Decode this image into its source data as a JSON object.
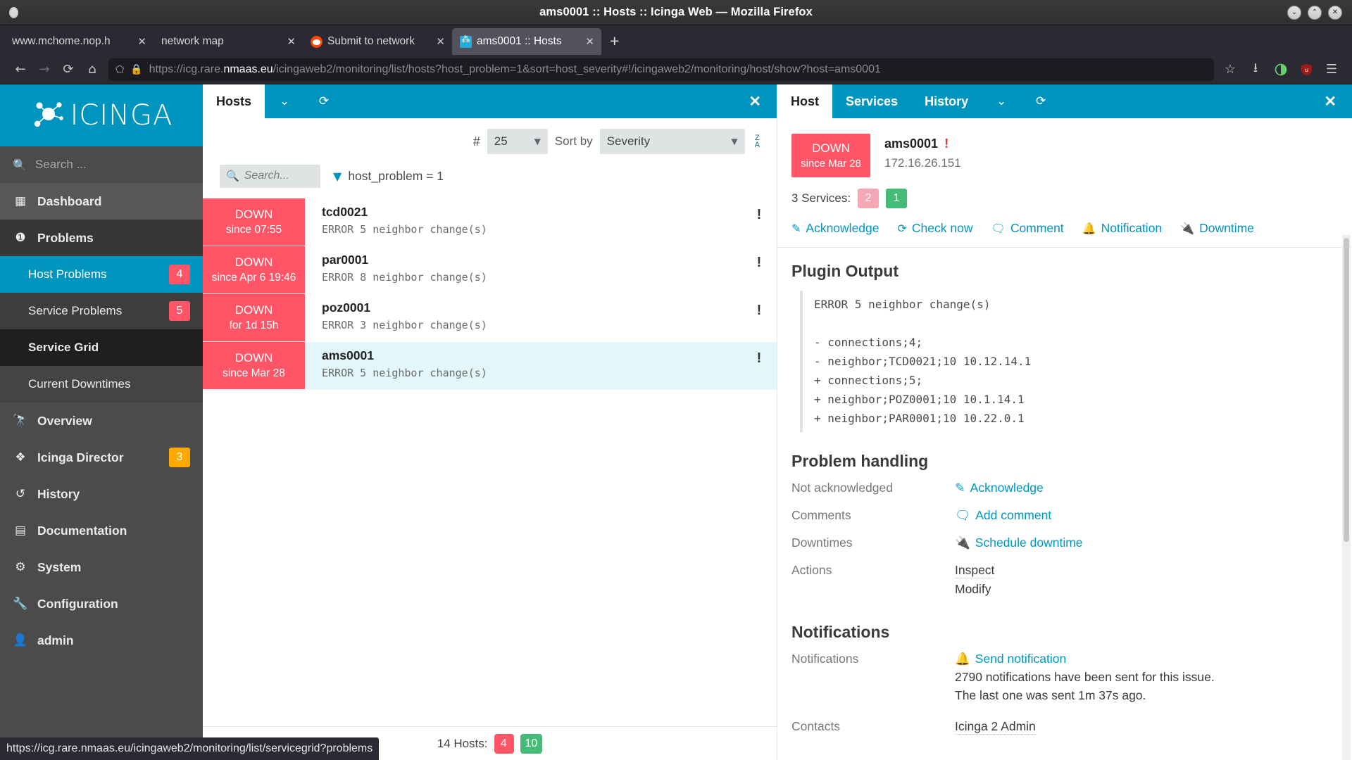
{
  "browser": {
    "window_title": "ams0001 :: Hosts :: Icinga Web — Mozilla Firefox",
    "window_controls": {
      "minimize": "⌄",
      "maximize": "⌃",
      "close": "✕"
    },
    "tabs": [
      {
        "label": "www.mchome.nop.h",
        "favicon": "generic-favicon",
        "active": false
      },
      {
        "label": "network map",
        "favicon": "none",
        "active": false
      },
      {
        "label": "Submit to network",
        "favicon": "reddit-favicon",
        "active": false
      },
      {
        "label": "ams0001 :: Hosts",
        "favicon": "icinga-favicon",
        "active": true
      }
    ],
    "new_tab_label": "+",
    "nav": {
      "back": "←",
      "forward": "→",
      "reload": "⟳",
      "home": "⌂",
      "shield_icon": "shield-icon",
      "lock_icon": "lock-icon",
      "url_prefix": "https://icg.rare.",
      "url_domain": "nmaas.eu",
      "url_suffix": "/icingaweb2/monitoring/list/hosts?host_problem=1&sort=host_severity#!/icingaweb2/monitoring/host/show?host=ams0001",
      "bookmark": "☆",
      "downloads": "⭳",
      "container": "◑",
      "extension": "U",
      "menu": "☰"
    },
    "status_tip": "https://icg.rare.nmaas.eu/icingaweb2/monitoring/list/servicegrid?problems"
  },
  "sidebar": {
    "brand": "ICINGA",
    "search": {
      "placeholder": "Search ...",
      "value": "",
      "icon": "search-icon"
    },
    "items": [
      {
        "label": "Dashboard",
        "icon": "grid-icon",
        "badge": null,
        "level": 1
      },
      {
        "label": "Problems",
        "icon": "exclamation-circle-icon",
        "badge": null,
        "level": 1
      },
      {
        "label": "Host Problems",
        "icon": null,
        "badge": "4",
        "badge_color": "red",
        "level": 2
      },
      {
        "label": "Service Problems",
        "icon": null,
        "badge": "5",
        "badge_color": "red",
        "level": 2
      },
      {
        "label": "Service Grid",
        "icon": null,
        "badge": null,
        "level": 2
      },
      {
        "label": "Current Downtimes",
        "icon": null,
        "badge": null,
        "level": 2
      },
      {
        "label": "Overview",
        "icon": "binoculars-icon",
        "badge": null,
        "level": 1
      },
      {
        "label": "Icinga Director",
        "icon": "cubes-icon",
        "badge": "3",
        "badge_color": "orange",
        "level": 1
      },
      {
        "label": "History",
        "icon": "history-icon",
        "badge": null,
        "level": 1
      },
      {
        "label": "Documentation",
        "icon": "book-icon",
        "badge": null,
        "level": 1
      },
      {
        "label": "System",
        "icon": "gears-icon",
        "badge": null,
        "level": 1
      },
      {
        "label": "Configuration",
        "icon": "wrench-icon",
        "badge": null,
        "level": 1
      },
      {
        "label": "admin",
        "icon": "user-icon",
        "badge": null,
        "level": 1
      }
    ]
  },
  "hosts_pane": {
    "tab_label": "Hosts",
    "dropdown_icon": "chevron-down-icon",
    "refresh_icon": "refresh-icon",
    "close_icon": "close-icon",
    "controls": {
      "hash_label": "#",
      "limit_value": "25",
      "sort_by_label": "Sort by",
      "sort_value": "Severity",
      "sort_direction_icon": "sort-desc-icon"
    },
    "search": {
      "placeholder": "Search...",
      "value": "",
      "icon": "search-icon"
    },
    "filter": {
      "icon": "filter-icon",
      "text": "host_problem = 1"
    },
    "rows": [
      {
        "state": "DOWN",
        "since": "since 07:55",
        "name": "tcd0021",
        "message": "ERROR 5 neighbor change(s)",
        "flag": "!",
        "selected": false
      },
      {
        "state": "DOWN",
        "since": "since Apr 6 19:46",
        "name": "par0001",
        "message": "ERROR 8 neighbor change(s)",
        "flag": "!",
        "selected": false
      },
      {
        "state": "DOWN",
        "since": "for 1d 15h",
        "name": "poz0001",
        "message": "ERROR 3 neighbor change(s)",
        "flag": "!",
        "selected": false
      },
      {
        "state": "DOWN",
        "since": "since Mar 28",
        "name": "ams0001",
        "message": "ERROR 5 neighbor change(s)",
        "flag": "!",
        "selected": true
      }
    ],
    "footer": {
      "label": "14 Hosts:",
      "down_count": "4",
      "up_count": "10"
    }
  },
  "detail_pane": {
    "tabs": [
      {
        "label": "Host",
        "active": true
      },
      {
        "label": "Services",
        "active": false
      },
      {
        "label": "History",
        "active": false
      }
    ],
    "dropdown_icon": "chevron-down-icon",
    "refresh_icon": "refresh-icon",
    "close_icon": "close-icon",
    "host": {
      "state": "DOWN",
      "since": "since Mar 28",
      "name": "ams0001",
      "flag": "!",
      "address": "172.16.26.151",
      "services_label": "3 Services:",
      "services_warn": "2",
      "services_ok": "1"
    },
    "actions": [
      {
        "label": "Acknowledge",
        "icon": "edit-icon"
      },
      {
        "label": "Check now",
        "icon": "refresh-icon"
      },
      {
        "label": "Comment",
        "icon": "comment-icon"
      },
      {
        "label": "Notification",
        "icon": "bell-icon"
      },
      {
        "label": "Downtime",
        "icon": "plug-icon"
      }
    ],
    "plugin_output": {
      "title": "Plugin Output",
      "lines": [
        "ERROR 5 neighbor change(s)",
        "",
        "- connections;4;",
        "- neighbor;TCD0021;10 10.12.14.1",
        "+ connections;5;",
        "+ neighbor;POZ0001;10 10.1.14.1",
        "+ neighbor;PAR0001;10 10.22.0.1"
      ]
    },
    "problem_handling": {
      "title": "Problem handling",
      "rows": [
        {
          "key": "Not acknowledged",
          "link": "Acknowledge",
          "link_icon": "edit-icon",
          "values": []
        },
        {
          "key": "Comments",
          "link": "Add comment",
          "link_icon": "comment-icon",
          "values": []
        },
        {
          "key": "Downtimes",
          "link": "Schedule downtime",
          "link_icon": "plug-icon",
          "values": []
        },
        {
          "key": "Actions",
          "link": null,
          "link_icon": null,
          "values": [
            "Inspect",
            "Modify"
          ]
        }
      ]
    },
    "notifications": {
      "title": "Notifications",
      "rows": [
        {
          "key": "Notifications",
          "link": "Send notification",
          "link_icon": "bell-icon",
          "values": [
            "2790 notifications have been sent for this issue.",
            "The last one was sent 1m 37s ago."
          ]
        },
        {
          "key": "Contacts",
          "link": null,
          "link_icon": null,
          "values": [
            "Icinga 2 Admin"
          ]
        }
      ]
    }
  },
  "colors": {
    "icinga_blue": "#0095bf",
    "state_down_red": "#ff5566",
    "state_ok_green": "#44bb77",
    "warn_orange": "#ffa800",
    "selected_row": "#e3f7fb"
  }
}
